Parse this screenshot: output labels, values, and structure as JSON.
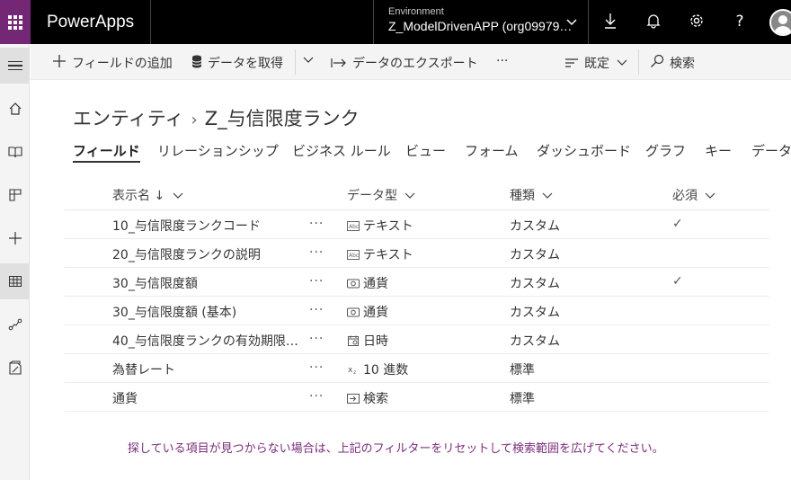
{
  "topbar": {
    "app_title": "PowerApps",
    "environment_label": "Environment",
    "environment_value": "Z_ModelDrivenAPP (org09979…",
    "icons": [
      "download-icon",
      "bell-icon",
      "gear-icon",
      "help-icon",
      "avatar"
    ]
  },
  "sidebar": {
    "items": [
      "hamburger-icon",
      "home-icon",
      "book-icon",
      "apps-icon",
      "plus-icon",
      "table-icon",
      "flow-icon",
      "report-icon"
    ]
  },
  "commandbar": {
    "add_field": "フィールドの追加",
    "get_data": "データを取得",
    "export_data": "データのエクスポート",
    "more": "···",
    "view": "既定",
    "search": "検索"
  },
  "breadcrumb": {
    "root": "エンティティ",
    "current": "Z_与信限度ランク"
  },
  "tabs": [
    "フィールド",
    "リレーションシップ",
    "ビジネス ルール",
    "ビュー",
    "フォーム",
    "ダッシュボード",
    "グラフ",
    "キー",
    "データ"
  ],
  "table": {
    "headers": {
      "name": "表示名 ↓",
      "type": "データ型",
      "kind": "種類",
      "required": "必須"
    },
    "rows": [
      {
        "name": "10_与信限度ランクコード",
        "more": "···",
        "type_icon": "Abc",
        "type": "テキスト",
        "kind": "カスタム",
        "required": "✓"
      },
      {
        "name": "20_与信限度ランクの説明",
        "more": "···",
        "type_icon": "Abc",
        "type": "テキスト",
        "kind": "カスタム",
        "required": ""
      },
      {
        "name": "30_与信限度額",
        "more": "···",
        "type_icon": "money",
        "type": "通貨",
        "kind": "カスタム",
        "required": "✓"
      },
      {
        "name": "30_与信限度額 (基本)",
        "more": "···",
        "type_icon": "money",
        "type": "通貨",
        "kind": "カスタム",
        "required": ""
      },
      {
        "name": "40_与信限度ランクの有効期限…",
        "more": "···",
        "type_icon": "calendar",
        "type": "日時",
        "kind": "カスタム",
        "required": ""
      },
      {
        "name": "為替レート",
        "more": "···",
        "type_icon": "decimal",
        "type": "10 進数",
        "kind": "標準",
        "required": ""
      },
      {
        "name": "通貨",
        "more": "···",
        "type_icon": "lookup",
        "type": "検索",
        "kind": "標準",
        "required": ""
      }
    ]
  },
  "footer": {
    "message": "探している項目が見つからない場合は、上記のフィルターをリセットして検索範囲を広げてください。"
  }
}
